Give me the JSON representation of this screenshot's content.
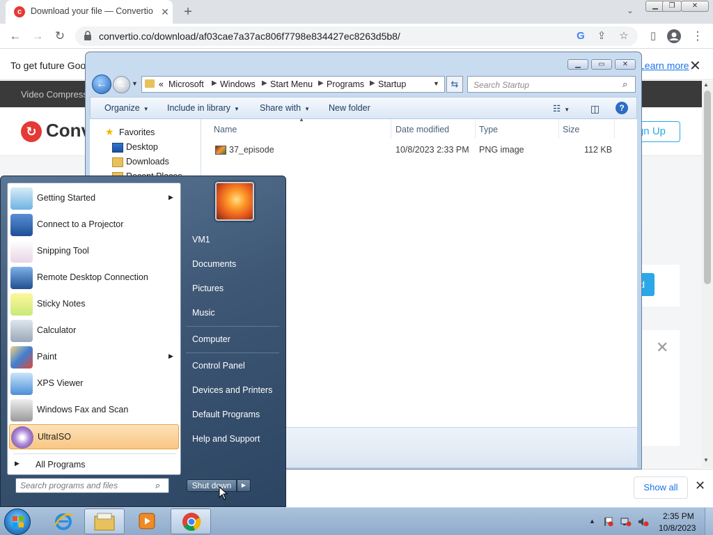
{
  "browser": {
    "tab_title": "Download your file — Convertio",
    "tab_favicon_letter": "c",
    "url": "convertio.co/download/af03cae7a37ac806f7798e834427ec8263d5b8/",
    "infobar_text": "To get future Goog",
    "infobar_link": "Learn more",
    "download_show_all": "Show all"
  },
  "website": {
    "nav_item": "Video Compress",
    "logo_text": "Conv",
    "signup_label": "Sign Up",
    "card_button_label": "d"
  },
  "explorer": {
    "breadcrumbs": [
      "Microsoft",
      "Windows",
      "Start Menu",
      "Programs",
      "Startup"
    ],
    "breadcrumb_prefix": "«",
    "search_placeholder": "Search Startup",
    "commands": {
      "organize": "Organize",
      "include_in_library": "Include in library",
      "share_with": "Share with",
      "new_folder": "New folder"
    },
    "nav": {
      "favorites": "Favorites",
      "desktop": "Desktop",
      "downloads": "Downloads",
      "recent_places": "Recent Places"
    },
    "columns": {
      "name": "Name",
      "date_modified": "Date modified",
      "type": "Type",
      "size": "Size"
    },
    "files": [
      {
        "name": "37_episode",
        "date_modified": "10/8/2023 2:33 PM",
        "type": "PNG image",
        "size": "112 KB"
      }
    ]
  },
  "start_menu": {
    "programs": [
      {
        "label": "Getting Started",
        "icon": "getting-started-icon",
        "submenu": true
      },
      {
        "label": "Connect to a Projector",
        "icon": "projector-icon",
        "submenu": false
      },
      {
        "label": "Snipping Tool",
        "icon": "scissors-icon",
        "submenu": false
      },
      {
        "label": "Remote Desktop Connection",
        "icon": "remote-desktop-icon",
        "submenu": false
      },
      {
        "label": "Sticky Notes",
        "icon": "sticky-notes-icon",
        "submenu": false
      },
      {
        "label": "Calculator",
        "icon": "calculator-icon",
        "submenu": false
      },
      {
        "label": "Paint",
        "icon": "paint-icon",
        "submenu": true
      },
      {
        "label": "XPS Viewer",
        "icon": "xps-viewer-icon",
        "submenu": false
      },
      {
        "label": "Windows Fax and Scan",
        "icon": "fax-icon",
        "submenu": false
      },
      {
        "label": "UltraISO",
        "icon": "ultraiso-icon",
        "submenu": false,
        "highlighted": true
      }
    ],
    "all_programs": "All Programs",
    "search_placeholder": "Search programs and files",
    "right_links": [
      "VM1",
      "Documents",
      "Pictures",
      "Music",
      "Computer",
      "Control Panel",
      "Devices and Printers",
      "Default Programs",
      "Help and Support"
    ],
    "shutdown_label": "Shut down"
  },
  "taskbar": {
    "clock_time": "2:35 PM",
    "clock_date": "10/8/2023"
  }
}
